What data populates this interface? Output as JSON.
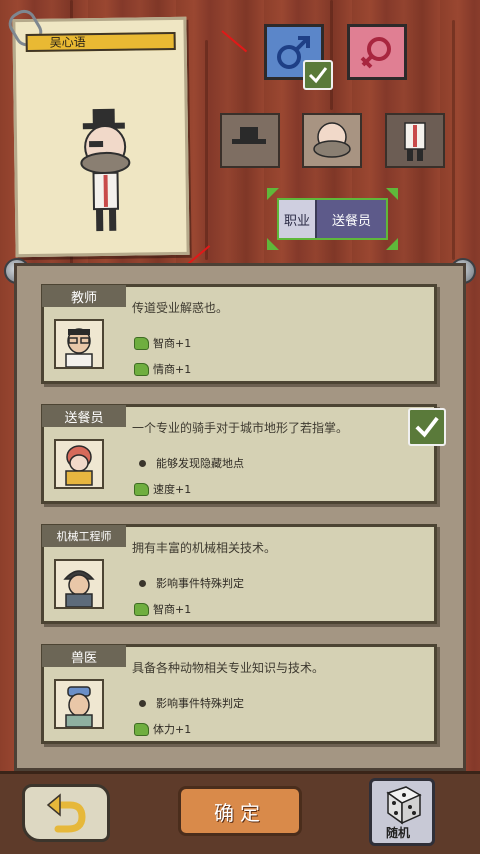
{
  "character": {
    "name": "吴心语"
  },
  "gender": {
    "male_icon": "male-symbol-icon",
    "female_icon": "female-symbol-icon",
    "selected": "male"
  },
  "parts": [
    "hat-part",
    "face-beard-part",
    "outfit-part"
  ],
  "job_selector": {
    "label": "职业",
    "value": "送餐员"
  },
  "jobs": [
    {
      "title": "教师",
      "desc": "传道受业解惑也。",
      "lines": [
        {
          "kind": "thumb",
          "text": "智商+1"
        },
        {
          "kind": "thumb",
          "text": "情商+1"
        }
      ],
      "selected": false
    },
    {
      "title": "送餐员",
      "desc": "一个专业的骑手对于城市地形了若指掌。",
      "lines": [
        {
          "kind": "dot",
          "text": "能够发现隐藏地点"
        },
        {
          "kind": "thumb",
          "text": "速度+1"
        }
      ],
      "selected": true
    },
    {
      "title": "机械工程师",
      "desc": "拥有丰富的机械相关技术。",
      "lines": [
        {
          "kind": "dot",
          "text": "影响事件特殊判定"
        },
        {
          "kind": "thumb",
          "text": "智商+1"
        }
      ],
      "selected": false
    },
    {
      "title": "兽医",
      "desc": "具备各种动物相关专业知识与技术。",
      "lines": [
        {
          "kind": "dot",
          "text": "影响事件特殊判定"
        },
        {
          "kind": "thumb",
          "text": "体力+1"
        }
      ],
      "selected": false
    }
  ],
  "buttons": {
    "confirm": "确定",
    "random": "随机"
  },
  "colors": {
    "accent_green": "#5fb83a",
    "male_blue": "#5b86c9",
    "female_pink": "#e07f93",
    "confirm_orange": "#d98a4a"
  }
}
